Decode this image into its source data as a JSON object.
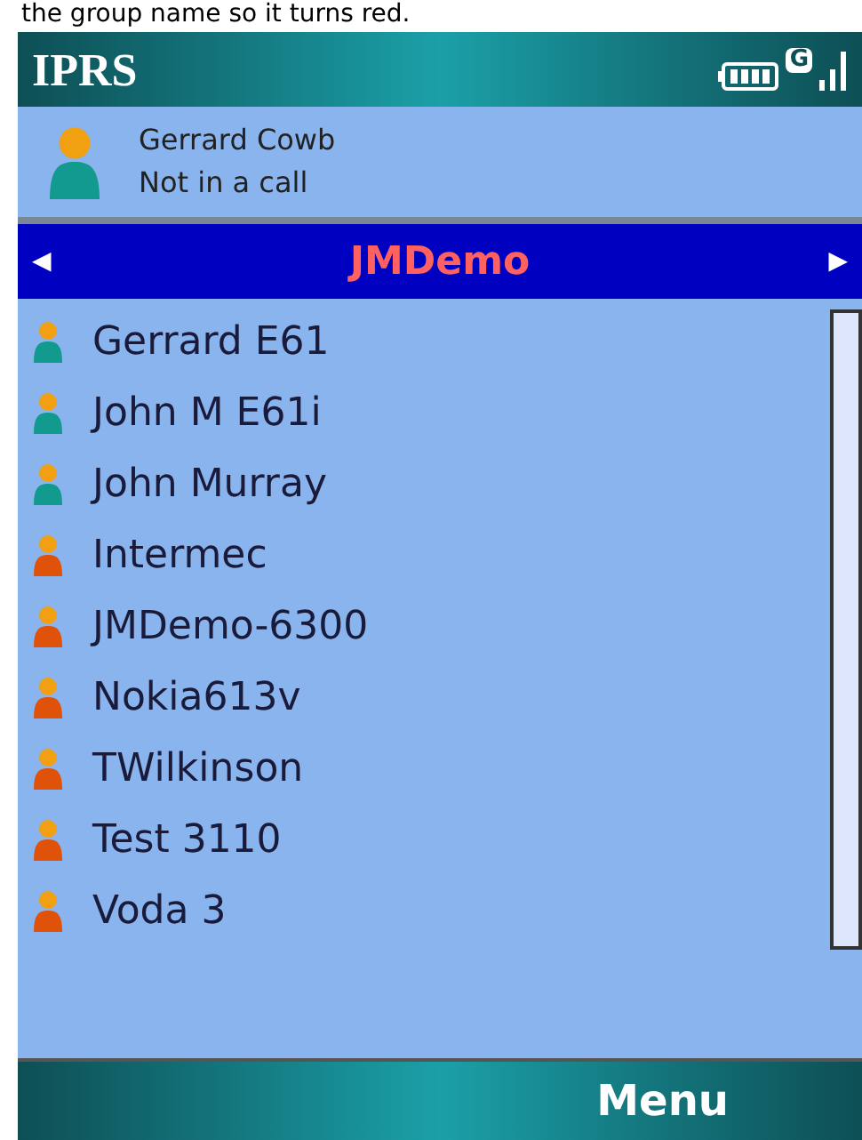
{
  "caption": "the group name so it turns red.",
  "title_bar": {
    "title": "IPRS",
    "network": "G"
  },
  "user": {
    "name": "Gerrard Cowb",
    "status": "Not in a call",
    "online": true
  },
  "group": {
    "name": "JMDemo",
    "left": "◀",
    "right": "▶"
  },
  "contacts": [
    {
      "name": "Gerrard E61",
      "online": true
    },
    {
      "name": "John M E61i",
      "online": true
    },
    {
      "name": "John Murray",
      "online": true
    },
    {
      "name": "Intermec",
      "online": false
    },
    {
      "name": "JMDemo-6300",
      "online": false
    },
    {
      "name": "Nokia613v",
      "online": false
    },
    {
      "name": "TWilkinson",
      "online": false
    },
    {
      "name": "Test 3110",
      "online": false
    },
    {
      "name": "Voda 3",
      "online": false
    }
  ],
  "softkeys": {
    "right": "Menu"
  }
}
